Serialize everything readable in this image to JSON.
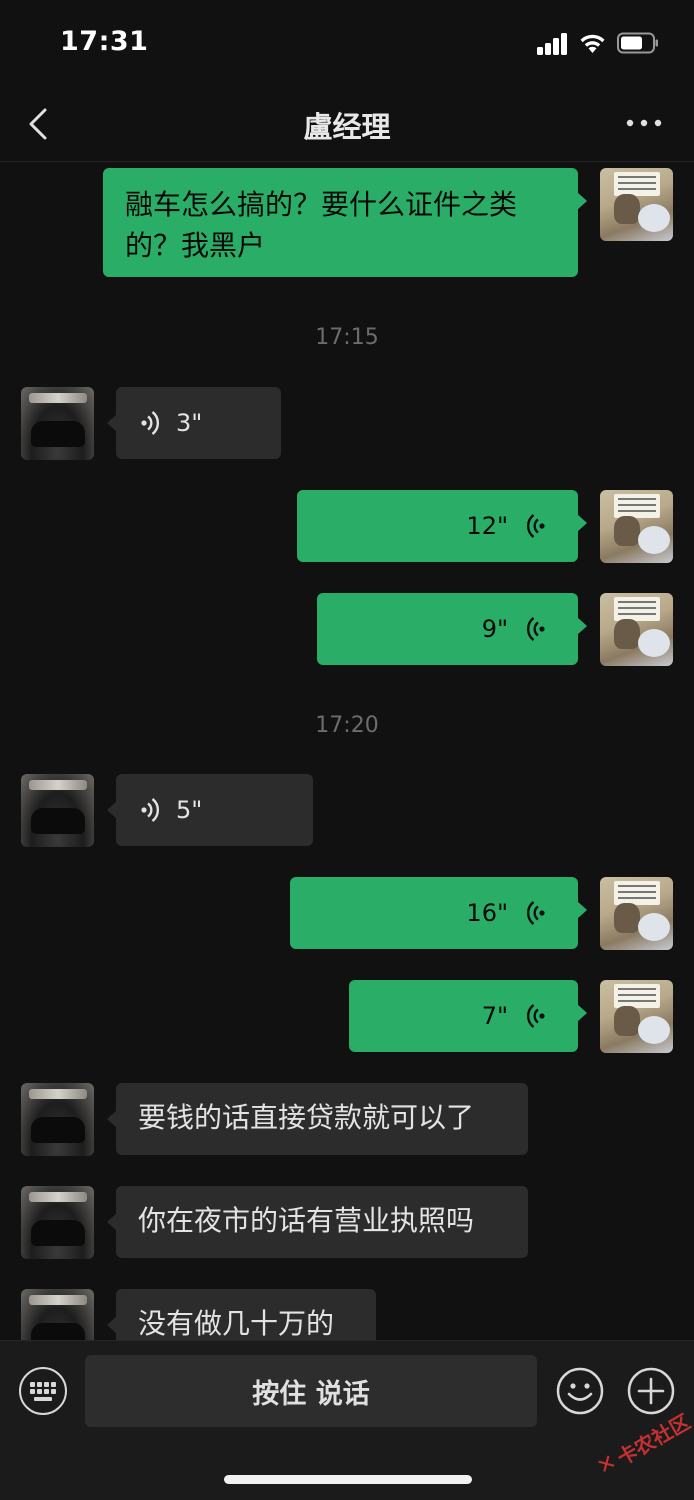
{
  "status_bar": {
    "time": "17:31"
  },
  "header": {
    "title": "盧经理"
  },
  "messages": [
    {
      "type": "text",
      "from": "self",
      "text": "融车怎么搞的？要什么证件之类的？我黑户"
    },
    {
      "type": "time",
      "text": "17:15"
    },
    {
      "type": "voice",
      "from": "other",
      "duration": "3\""
    },
    {
      "type": "voice",
      "from": "self",
      "duration": "12\""
    },
    {
      "type": "voice",
      "from": "self",
      "duration": "9\""
    },
    {
      "type": "time",
      "text": "17:20"
    },
    {
      "type": "voice",
      "from": "other",
      "duration": "5\""
    },
    {
      "type": "voice",
      "from": "self",
      "duration": "16\""
    },
    {
      "type": "voice",
      "from": "self",
      "duration": "7\""
    },
    {
      "type": "text",
      "from": "other",
      "text": "要钱的话直接贷款就可以了"
    },
    {
      "type": "text",
      "from": "other",
      "text": "你在夜市的话有营业执照吗"
    },
    {
      "type": "text",
      "from": "other",
      "text": "没有做几十万的"
    }
  ],
  "input_bar": {
    "hold_to_talk_label": "按住 说话"
  },
  "watermark": {
    "text": "卡农社区"
  },
  "colors": {
    "sent_bubble": "#2aae67",
    "received_bubble": "#2c2c2c",
    "background": "#111111"
  },
  "icons": [
    "signal-icon",
    "wifi-icon",
    "battery-icon",
    "back-icon",
    "more-icon",
    "voice-wave-icon",
    "keyboard-icon",
    "emoji-icon",
    "plus-icon"
  ]
}
